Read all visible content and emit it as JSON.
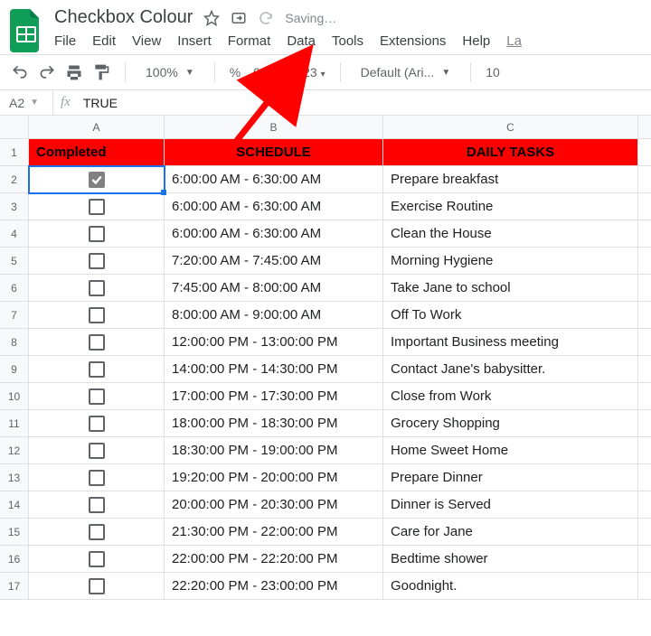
{
  "doc_title": "Checkbox Colour",
  "saving_text": "Saving…",
  "menus": [
    "File",
    "Edit",
    "View",
    "Insert",
    "Format",
    "Data",
    "Tools",
    "Extensions",
    "Help"
  ],
  "last_menu_partial": "La",
  "toolbar": {
    "zoom": "100%",
    "percent": "%",
    "dec_dec": ".0",
    "dec_inc": ".00",
    "num_fmt": "123",
    "font": "Default (Ari...",
    "font_size": "10"
  },
  "cell_ref": "A2",
  "fx_label": "fx",
  "fx_value": "TRUE",
  "col_headers": [
    "A",
    "B",
    "C"
  ],
  "table_headers": {
    "a": "Completed",
    "b": "SCHEDULE",
    "c": "DAILY TASKS"
  },
  "rows": [
    {
      "n": "2",
      "checked": true,
      "schedule": "6:00:00 AM - 6:30:00 AM",
      "task": "Prepare breakfast"
    },
    {
      "n": "3",
      "checked": false,
      "schedule": "6:00:00 AM - 6:30:00 AM",
      "task": "Exercise Routine"
    },
    {
      "n": "4",
      "checked": false,
      "schedule": "6:00:00 AM - 6:30:00 AM",
      "task": "Clean the House"
    },
    {
      "n": "5",
      "checked": false,
      "schedule": "7:20:00 AM - 7:45:00 AM",
      "task": "Morning Hygiene"
    },
    {
      "n": "6",
      "checked": false,
      "schedule": "7:45:00 AM - 8:00:00 AM",
      "task": "Take Jane to school"
    },
    {
      "n": "7",
      "checked": false,
      "schedule": "8:00:00 AM - 9:00:00 AM",
      "task": "Off To Work"
    },
    {
      "n": "8",
      "checked": false,
      "schedule": "12:00:00 PM - 13:00:00 PM",
      "task": "Important Business meeting"
    },
    {
      "n": "9",
      "checked": false,
      "schedule": "14:00:00 PM - 14:30:00 PM",
      "task": "Contact Jane's babysitter."
    },
    {
      "n": "10",
      "checked": false,
      "schedule": "17:00:00 PM - 17:30:00 PM",
      "task": "Close from Work"
    },
    {
      "n": "11",
      "checked": false,
      "schedule": "18:00:00 PM - 18:30:00 PM",
      "task": "Grocery Shopping"
    },
    {
      "n": "12",
      "checked": false,
      "schedule": "18:30:00 PM - 19:00:00 PM",
      "task": "Home Sweet Home"
    },
    {
      "n": "13",
      "checked": false,
      "schedule": "19:20:00 PM - 20:00:00 PM",
      "task": "Prepare Dinner"
    },
    {
      "n": "14",
      "checked": false,
      "schedule": "20:00:00 PM - 20:30:00 PM",
      "task": "Dinner is Served"
    },
    {
      "n": "15",
      "checked": false,
      "schedule": "21:30:00 PM - 22:00:00 PM",
      "task": "Care for Jane"
    },
    {
      "n": "16",
      "checked": false,
      "schedule": "22:00:00 PM - 22:20:00 PM",
      "task": "Bedtime shower"
    },
    {
      "n": "17",
      "checked": false,
      "schedule": "22:20:00 PM - 23:00:00 PM",
      "task": "Goodnight."
    }
  ],
  "header_row_num": "1"
}
